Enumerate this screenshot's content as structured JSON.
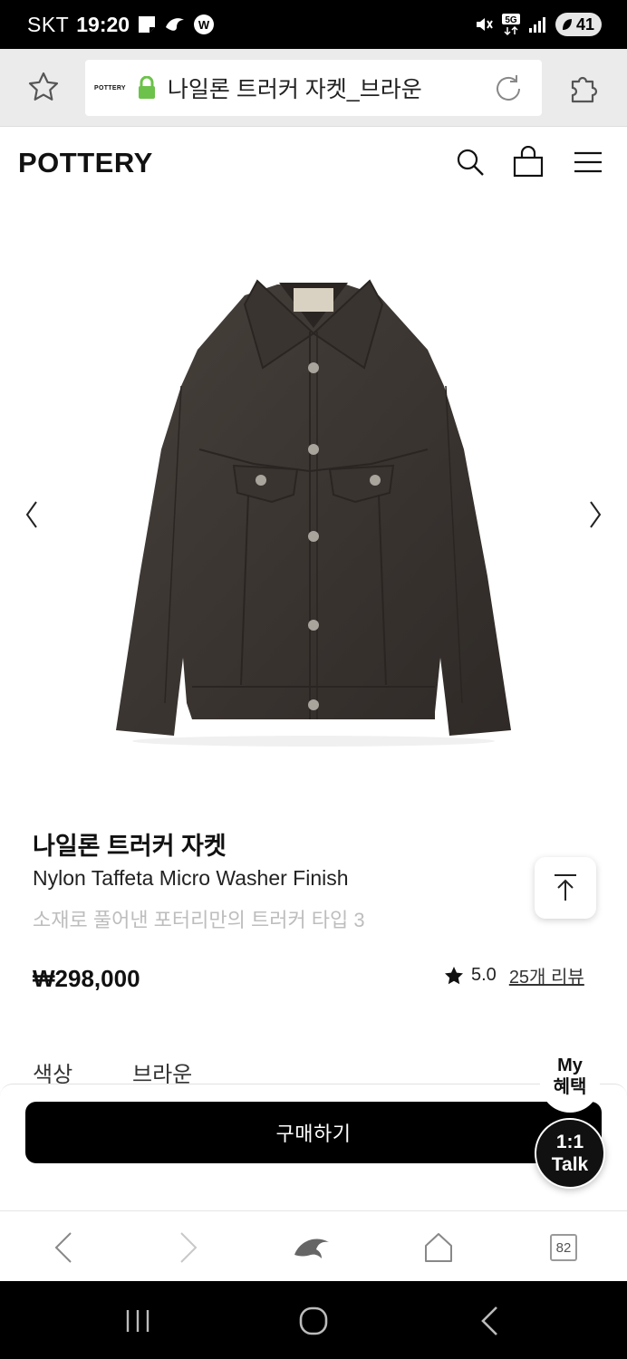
{
  "status_bar": {
    "carrier": "SKT",
    "time": "19:20",
    "network": "5G",
    "battery": "41"
  },
  "browser": {
    "site_badge": "POTTERY",
    "page_title": "나일론 트러커 자켓_브라운",
    "tab_count": "82"
  },
  "site": {
    "brand": "POTTERY"
  },
  "product": {
    "name_ko": "나일론 트러커 자켓",
    "name_en": "Nylon Taffeta Micro Washer Finish",
    "description": "소재로 풀어낸 포터리만의 트러커 타입 3",
    "price": "₩298,000",
    "rating": "5.0",
    "review_link": "25개 리뷰",
    "option_label": "색상",
    "option_value": "브라운"
  },
  "actions": {
    "buy_label": "구매하기",
    "my_benefit_line1": "My",
    "my_benefit_line2": "혜택",
    "talk_line1": "1:1",
    "talk_line2": "Talk"
  },
  "colors": {
    "jacket": "#3b3632",
    "lock": "#6cc24a",
    "button": "#000000"
  }
}
